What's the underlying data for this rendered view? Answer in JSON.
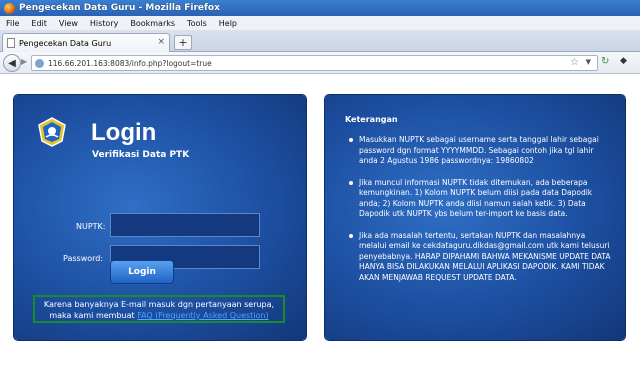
{
  "window": {
    "title": "Pengecekan Data Guru - Mozilla Firefox"
  },
  "menu": [
    "File",
    "Edit",
    "View",
    "History",
    "Bookmarks",
    "Tools",
    "Help"
  ],
  "tab": {
    "title": "Pengecekan Data Guru"
  },
  "url": "116.66.201.163:8083/info.php?logout=true",
  "login": {
    "title": "Login",
    "subtitle": "Verifikasi Data PTK",
    "nuptk_label": "NUPTK:",
    "password_label": "Password:",
    "button": "Login",
    "notice_line1": "Karena banyaknya E-mail masuk dgn pertanyaan serupa,",
    "notice_line2_prefix": "maka kami membuat ",
    "notice_link": "FAQ (Frequently Asked Question)"
  },
  "keterangan": {
    "title": "Keterangan",
    "items": [
      "Masukkan NUPTK sebagai username serta tanggal lahir sebagai password dgn format YYYYMMDD. Sebagai contoh jika tgl lahir anda 2 Agustus 1986 passwordnya: 19860802",
      "Jika muncul informasi NUPTK tidak ditemukan, ada beberapa kemungkinan. 1) Kolom NUPTK belum diisi pada data Dapodik anda; 2) Kolom NUPTK anda diisi namun salah ketik. 3) Data Dapodik utk NUPTK ybs belum ter-import ke basis data.",
      "Jika ada masalah tertentu, sertakan NUPTK dan masalahnya melalui email ke cekdataguru.dikdas@gmail.com utk kami telusuri penyebabnya. HARAP DIPAHAMI BAHWA MEKANISME UPDATE DATA HANYA BISA DILAKUKAN MELALUI APLIKASI DAPODIK. KAMI TIDAK AKAN MENJAWAB REQUEST UPDATE DATA."
    ]
  },
  "colors": {
    "panel": "#1d4fa1",
    "link": "#4fa3ff",
    "notice_border": "#1c8b27"
  }
}
